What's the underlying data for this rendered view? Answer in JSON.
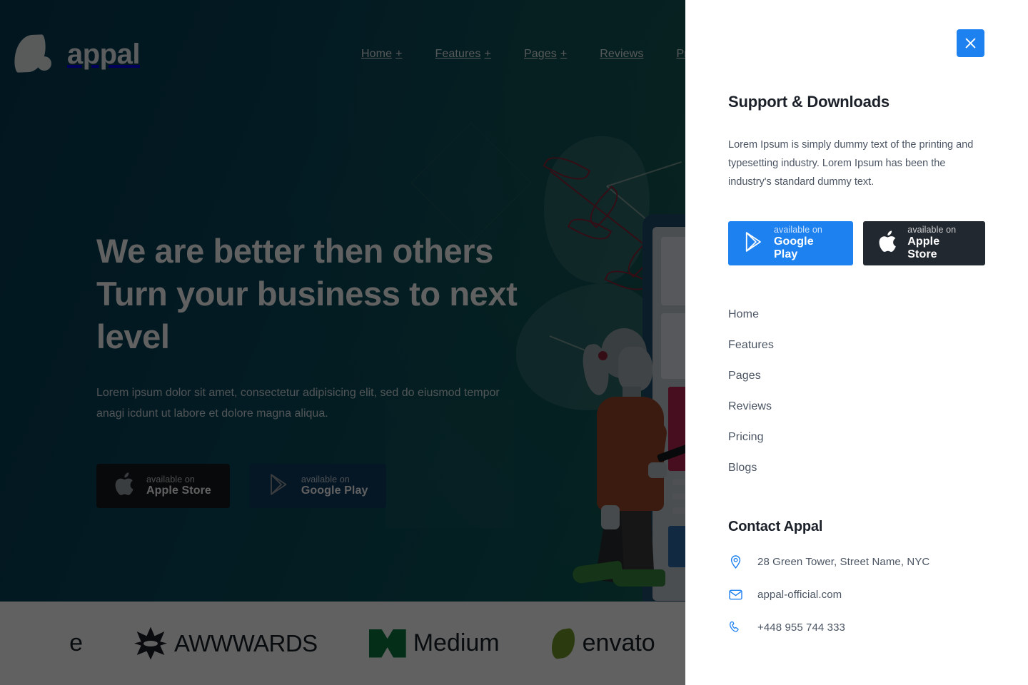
{
  "site": {
    "brand_name": "appal",
    "brand_logo_icon": "leaf-dot-logo-icon",
    "nav": [
      {
        "label": "Home",
        "has_dropdown": true,
        "plus": "+"
      },
      {
        "label": "Features",
        "has_dropdown": true,
        "plus": "+"
      },
      {
        "label": "Pages",
        "has_dropdown": true,
        "plus": "+"
      },
      {
        "label": "Reviews",
        "has_dropdown": false,
        "plus": ""
      },
      {
        "label": "Pricing",
        "has_dropdown": false,
        "plus": ""
      }
    ]
  },
  "hero": {
    "title": "We are better then others Turn your business to next level",
    "subtitle": "Lorem ipsum dolor sit amet, consectetur adipisicing elit, sed do eiusmod tempor anagi icdunt ut labore et dolore magna aliqua.",
    "buttons": [
      {
        "small": "available on",
        "big": "Apple Store",
        "icon": "apple-icon",
        "style": "dark"
      },
      {
        "small": "available on",
        "big": "Google Play",
        "icon": "google-play-icon",
        "style": "blue-dk"
      }
    ]
  },
  "partners": [
    {
      "name": "clipped-logo",
      "text": "e",
      "icon": ""
    },
    {
      "name": "awwwards",
      "text": "AWWWARDS",
      "icon": "awwwards-star-icon"
    },
    {
      "name": "medium",
      "text": "Medium",
      "icon": "medium-m-icon"
    },
    {
      "name": "envato",
      "text": "envato",
      "icon": "envato-leaf-icon"
    },
    {
      "name": "blue-mark",
      "text": "",
      "icon": "blue-chevron-icon"
    }
  ],
  "panel": {
    "close_icon": "close-icon",
    "title": "Support & Downloads",
    "description": "Lorem Ipsum is simply dummy text of the printing and typesetting industry. Lorem Ipsum has been the industry's standard dummy text.",
    "store_buttons": [
      {
        "small": "available on",
        "big": "Google Play",
        "icon": "google-play-icon",
        "style": "blue"
      },
      {
        "small": "available on",
        "big": "Apple Store",
        "icon": "apple-icon",
        "style": "black"
      }
    ],
    "links": [
      {
        "label": "Home"
      },
      {
        "label": "Features"
      },
      {
        "label": "Pages"
      },
      {
        "label": "Reviews"
      },
      {
        "label": "Pricing"
      },
      {
        "label": "Blogs"
      }
    ],
    "contact_title": "Contact Appal",
    "contact": [
      {
        "icon": "location-pin-icon",
        "text": "28 Green Tower, Street Name, NYC"
      },
      {
        "icon": "envelope-icon",
        "text": "appal-official.com"
      },
      {
        "icon": "phone-icon",
        "text": "+448 955 744 333"
      }
    ]
  },
  "colors": {
    "accent_blue": "#1e81f0",
    "dark_button": "#222830",
    "hero_gradient_start": "#073b52",
    "hero_gradient_end": "#19704f",
    "heading": "#1b2029",
    "body_text": "#4b5563"
  }
}
